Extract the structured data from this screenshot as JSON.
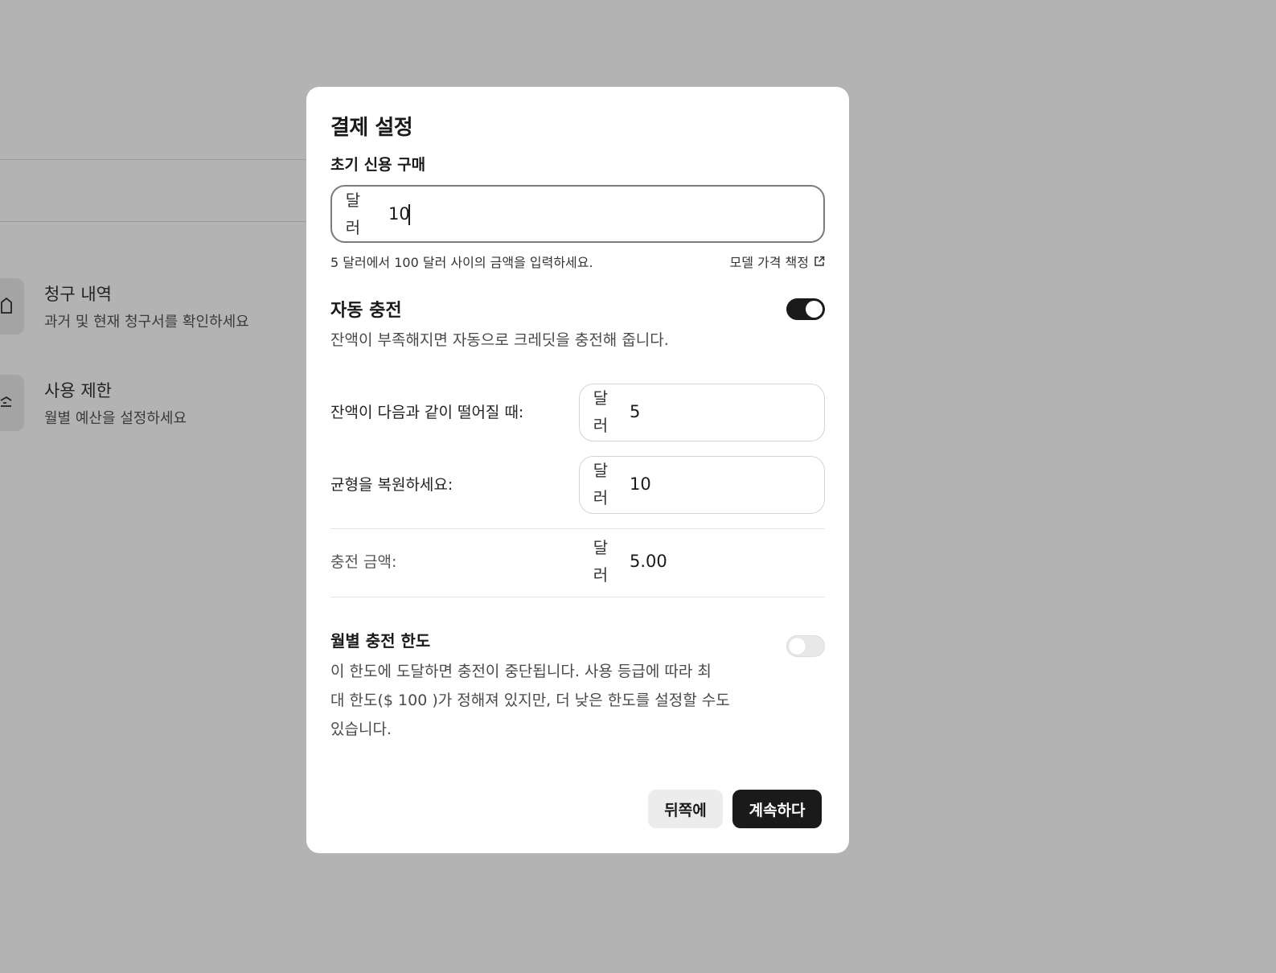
{
  "background": {
    "items": [
      {
        "title": "청구 내역",
        "subtitle": "과거 및 현재 청구서를 확인하세요",
        "icon": "receipt-icon"
      },
      {
        "title": "사용 제한",
        "subtitle": "월별 예산을 설정하세요",
        "icon": "sliders-icon"
      }
    ]
  },
  "modal": {
    "title": "결제 설정",
    "initial_purchase": {
      "label": "초기 신용 구매",
      "prefix": "달러",
      "value": "10",
      "helper": "5 달러에서 100 달러 사이의 금액을 입력하세요.",
      "pricing_link": "모델 가격 책정",
      "pricing_link_icon": "external-link-icon"
    },
    "auto_recharge": {
      "label": "자동 충전",
      "enabled": true,
      "description": "잔액이 부족해지면 자동으로 크레딧을 충전해 줍니다.",
      "threshold_label": "잔액이 다음과 같이 떨어질 때:",
      "threshold_prefix": "달러",
      "threshold_value": "5",
      "restore_label": "균형을 복원하세요:",
      "restore_prefix": "달러",
      "restore_value": "10",
      "amount_label": "충전 금액:",
      "amount_prefix": "달러",
      "amount_value": "5.00"
    },
    "monthly_limit": {
      "label": "월별 충전 한도",
      "enabled": false,
      "description_line1": "이 한도에 도달하면 충전이 중단됩니다. 사용 등급에 따라 최",
      "description_line2": "대 한도($ 100 )가 정해져 있지만, 더 낮은 한도를 설정할 수도",
      "description_line3": "있습니다."
    },
    "buttons": {
      "back": "뒤쪽에",
      "continue": "계속하다"
    }
  },
  "colors": {
    "overlay": "#b3b3b3",
    "modal_bg": "#ffffff",
    "primary": "#1a1a1a",
    "secondary_button": "#ececec"
  }
}
